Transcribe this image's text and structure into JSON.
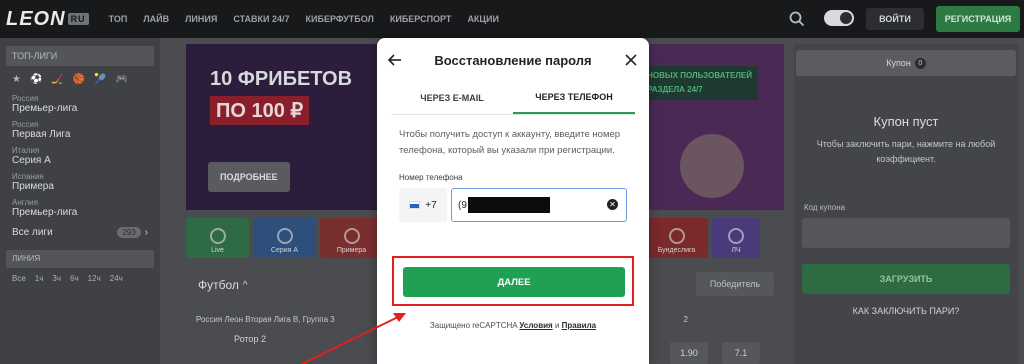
{
  "header": {
    "logo_text": "LEON",
    "logo_badge": "RU",
    "nav": [
      "ТОП",
      "ЛАЙВ",
      "ЛИНИЯ",
      "СТАВКИ 24/7",
      "КИБЕРФУТБОЛ",
      "КИБЕРСПОРТ",
      "АКЦИИ"
    ],
    "login_label": "ВОЙТИ",
    "register_label": "РЕГИСТРАЦИЯ"
  },
  "sidebar": {
    "top_leagues_label": "ТОП-ЛИГИ",
    "sport_icons": [
      "★",
      "⚽",
      "🏒",
      "🏀",
      "🎾",
      "🎮"
    ],
    "leagues": [
      {
        "country": "Россия",
        "name": "Премьер-лига"
      },
      {
        "country": "Россия",
        "name": "Первая Лига"
      },
      {
        "country": "Италия",
        "name": "Серия А"
      },
      {
        "country": "Испания",
        "name": "Примера"
      },
      {
        "country": "Англия",
        "name": "Премьер-лига"
      }
    ],
    "all_leagues_label": "Все лиги",
    "all_leagues_count": "293",
    "line_label": "ЛИНИЯ",
    "filters": [
      "Все",
      "1ч",
      "3ч",
      "6ч",
      "12ч",
      "24ч"
    ]
  },
  "banner": {
    "title": "10 ФРИБЕТОВ",
    "price": "ПО 100 ₽",
    "more_label": "ПОДРОБНЕЕ",
    "tag_line1": "НОВЫХ ПОЛЬЗОВАТЕЛЕЙ",
    "tag_line2": "РАЗДЕЛА 24/7"
  },
  "tiles": [
    {
      "label": "Live",
      "color": "#2e6b44"
    },
    {
      "label": "Серия А",
      "color": "#2d4f7a"
    },
    {
      "label": "Примера",
      "color": "#7a2f2f"
    },
    {
      "label": "Бундеслига",
      "color": "#7a2a2a"
    },
    {
      "label": "ЛЧ",
      "color": "#4a3a7a"
    }
  ],
  "main": {
    "sport_title": "Футбол",
    "winner_label": "Победитель",
    "match_league": "Россия  Леон Вторая Лига В, Группа 3",
    "match_number": "2",
    "team": "Ротор 2",
    "odd1": "1.90",
    "odd2": "7.1"
  },
  "coupon": {
    "title": "Купон",
    "count": "0",
    "empty_title": "Купон пуст",
    "empty_text": "Чтобы заключить пари, нажмите на любой коэффициент.",
    "code_label": "Код купона",
    "upload_label": "ЗАГРУЗИТЬ",
    "how_label": "КАК ЗАКЛЮЧИТЬ ПАРИ?"
  },
  "modal": {
    "title": "Восстановление пароля",
    "back_icon": "arrow-left",
    "close_icon": "close",
    "tabs": [
      {
        "label": "ЧЕРЕЗ E-MAIL",
        "active": false
      },
      {
        "label": "ЧЕРЕЗ ТЕЛЕФОН",
        "active": true
      }
    ],
    "instructions": "Чтобы получить доступ к аккаунту, введите номер телефона, который вы указали при регистрации.",
    "phone_label": "Номер телефона",
    "country_code": "+7",
    "phone_prefix": "(9",
    "next_label": "ДАЛЕЕ",
    "captcha_prefix": "Защищено reCAPTCHA",
    "captcha_terms": "Условия",
    "captcha_and": "и",
    "captcha_privacy": "Правила"
  },
  "colors": {
    "accent_green": "#20a052",
    "highlight_red": "#e02020",
    "input_focus": "#6d9be0"
  }
}
